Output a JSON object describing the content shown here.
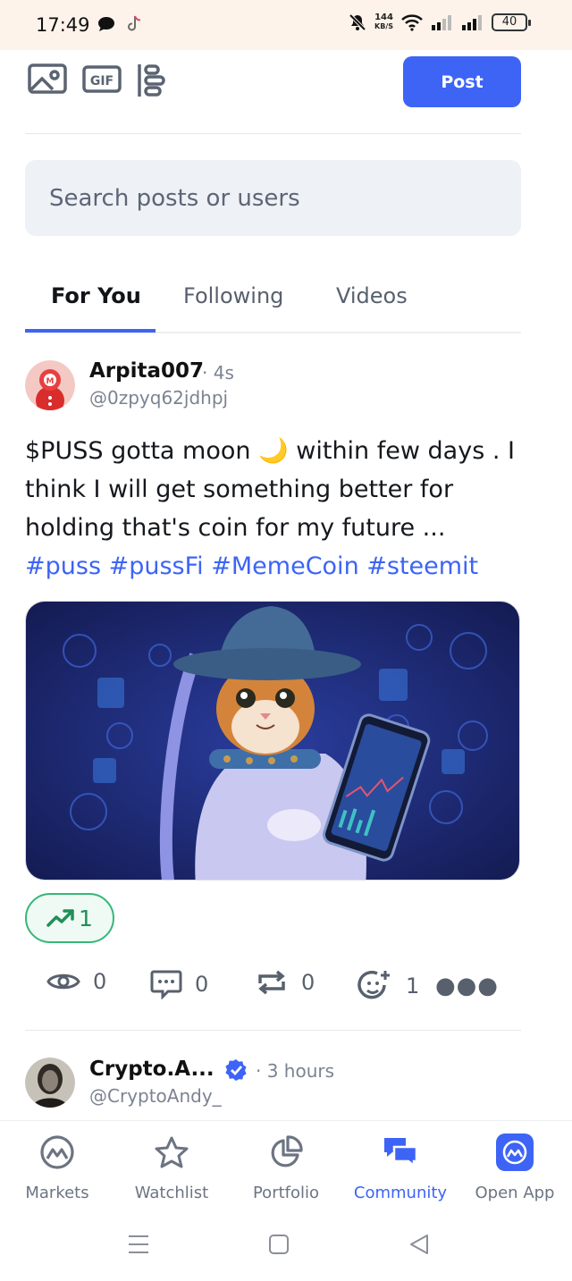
{
  "status_bar": {
    "time": "17:49",
    "speed_value": "144",
    "speed_unit": "KB/S",
    "battery": "40"
  },
  "composer": {
    "post_label": "Post"
  },
  "search": {
    "placeholder": "Search posts or users"
  },
  "tabs": [
    {
      "label": "For You",
      "active": true
    },
    {
      "label": "Following",
      "active": false
    },
    {
      "label": "Videos",
      "active": false
    }
  ],
  "posts": [
    {
      "author": "Arpita007",
      "time": "· 4s",
      "handle": "@0zpyq62jdhpj",
      "text_line1": "$PUSS gotta moon 🌙 within few days . I",
      "text_line2": "think I will get something better for",
      "text_line3": "holding that's coin for my future ...",
      "hashtags": "#puss #pussFi #MemeCoin #steemit",
      "trend_count": "1",
      "stats": {
        "views": "0",
        "comments": "0",
        "reposts": "0",
        "reactions": "1"
      }
    },
    {
      "author": "Crypto.A...",
      "time": "· 3 hours",
      "handle": "@CryptoAndy_"
    }
  ],
  "bottom_nav": [
    {
      "label": "Markets",
      "icon": "markets-icon"
    },
    {
      "label": "Watchlist",
      "icon": "star-icon"
    },
    {
      "label": "Portfolio",
      "icon": "pie-chart-icon"
    },
    {
      "label": "Community",
      "icon": "chat-icon",
      "active": true
    },
    {
      "label": "Open App",
      "icon": "app-logo-icon"
    }
  ],
  "colors": {
    "accent": "#3d64f5",
    "trend_green": "#34b77a",
    "status_bar_bg": "#fdf3ea"
  }
}
